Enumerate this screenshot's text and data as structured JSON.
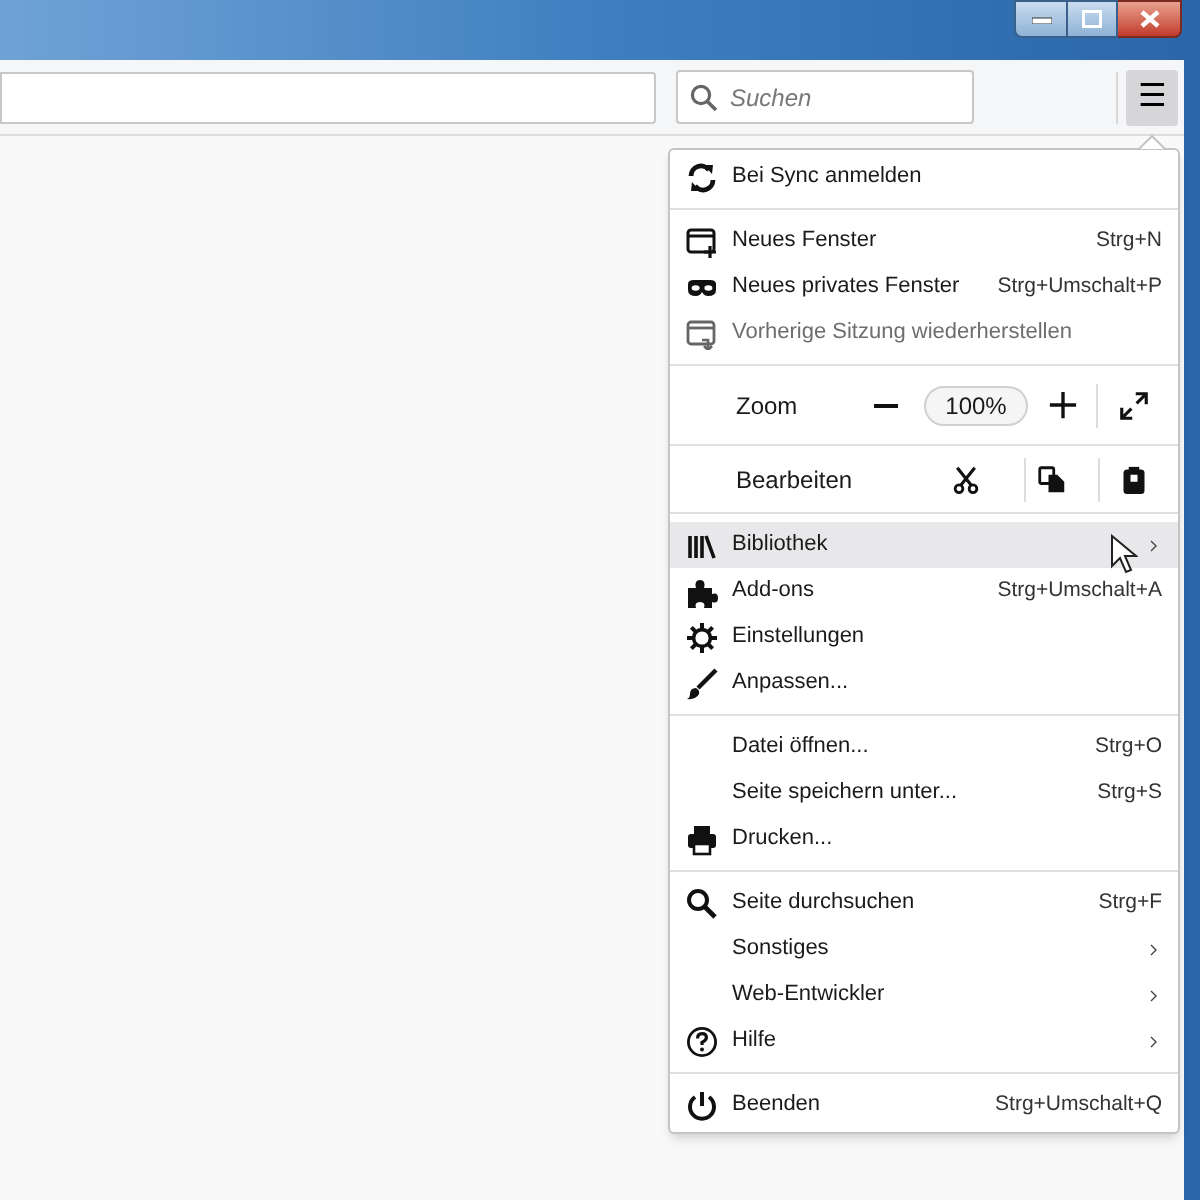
{
  "toolbar": {
    "search": {
      "placeholder": "Suchen"
    },
    "menu_button": {
      "label": "☰",
      "selected": true
    }
  },
  "menu": {
    "sections": [
      {
        "items": [
          {
            "kind": "item",
            "label": "Bei Sync anmelden",
            "disabled": false,
            "selected": false,
            "submenu": false
          }
        ]
      },
      {
        "items": [
          {
            "kind": "item",
            "label": "Neues Fenster",
            "shortcut": "Strg+N",
            "disabled": false,
            "selected": false,
            "submenu": false
          },
          {
            "kind": "item",
            "label": "Neues privates Fenster",
            "shortcut": "Strg+Umschalt+P",
            "disabled": false,
            "selected": false,
            "submenu": false
          },
          {
            "kind": "item",
            "label": "Vorherige Sitzung wiederherstellen",
            "disabled": true,
            "selected": false,
            "submenu": false
          }
        ]
      },
      {
        "items": [
          {
            "kind": "zoom",
            "label": "Zoom",
            "value": "100%"
          }
        ]
      },
      {
        "items": [
          {
            "kind": "edit",
            "label": "Bearbeiten"
          }
        ]
      },
      {
        "items": [
          {
            "kind": "item",
            "label": "Bibliothek",
            "disabled": false,
            "selected": true,
            "submenu": true
          },
          {
            "kind": "item",
            "label": "Add-ons",
            "shortcut": "Strg+Umschalt+A",
            "disabled": false,
            "selected": false,
            "submenu": false
          },
          {
            "kind": "item",
            "label": "Einstellungen",
            "disabled": false,
            "selected": false,
            "submenu": false
          },
          {
            "kind": "item",
            "label": "Anpassen...",
            "disabled": false,
            "selected": false,
            "submenu": false
          }
        ]
      },
      {
        "items": [
          {
            "kind": "item",
            "label": "Datei öffnen...",
            "shortcut": "Strg+O",
            "disabled": false,
            "selected": false,
            "submenu": false
          },
          {
            "kind": "item",
            "label": "Seite speichern unter...",
            "shortcut": "Strg+S",
            "disabled": false,
            "selected": false,
            "submenu": false
          },
          {
            "kind": "item",
            "label": "Drucken...",
            "disabled": false,
            "selected": false,
            "submenu": false
          }
        ]
      },
      {
        "items": [
          {
            "kind": "item",
            "label": "Seite durchsuchen",
            "shortcut": "Strg+F",
            "disabled": false,
            "selected": false,
            "submenu": false
          },
          {
            "kind": "item",
            "label": "Sonstiges",
            "disabled": false,
            "selected": false,
            "submenu": true
          },
          {
            "kind": "item",
            "label": "Web-Entwickler",
            "disabled": false,
            "selected": false,
            "submenu": true
          },
          {
            "kind": "item",
            "label": "Hilfe",
            "disabled": false,
            "selected": false,
            "submenu": true
          }
        ]
      },
      {
        "items": [
          {
            "kind": "item",
            "label": "Beenden",
            "shortcut": "Strg+Umschalt+Q",
            "disabled": false,
            "selected": false,
            "submenu": false
          }
        ]
      }
    ]
  }
}
